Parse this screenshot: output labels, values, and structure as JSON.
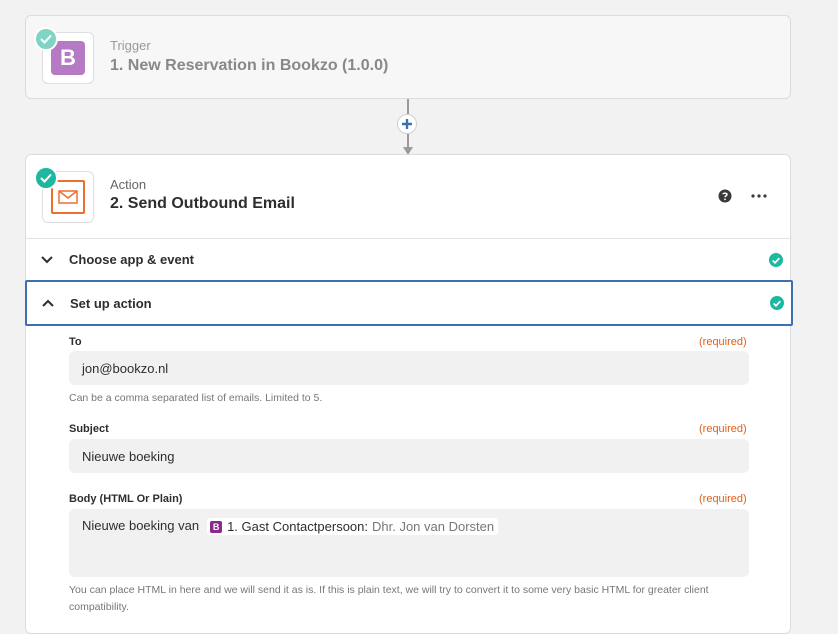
{
  "trigger": {
    "type_label": "Trigger",
    "title": "1. New Reservation in Bookzo (1.0.0)",
    "app_logo_letter": "B"
  },
  "action": {
    "type_label": "Action",
    "title": "2. Send Outbound Email"
  },
  "sections": {
    "choose_app": "Choose app & event",
    "setup_action": "Set up action"
  },
  "fields": {
    "to": {
      "label": "To",
      "required": "(required)",
      "value": "jon@bookzo.nl",
      "hint": "Can be a comma separated list of emails. Limited to 5."
    },
    "subject": {
      "label": "Subject",
      "required": "(required)",
      "value": "Nieuwe boeking"
    },
    "body": {
      "label": "Body (HTML Or Plain)",
      "required": "(required)",
      "text": "Nieuwe boeking van",
      "pill_logo": "B",
      "pill_label": "1. Gast Contactpersoon:",
      "pill_value": "Dhr. Jon van Dorsten",
      "hint": "You can place HTML in here and we will send it as is. If this is plain text, we will try to convert it to some very basic HTML for greater client compatibility."
    }
  },
  "colors": {
    "accent_blue": "#3f6fb3",
    "success_green": "#1db89f",
    "required_orange": "#e0601b",
    "bookzo_purple": "#b679c3",
    "email_orange": "#ee6f2d"
  }
}
